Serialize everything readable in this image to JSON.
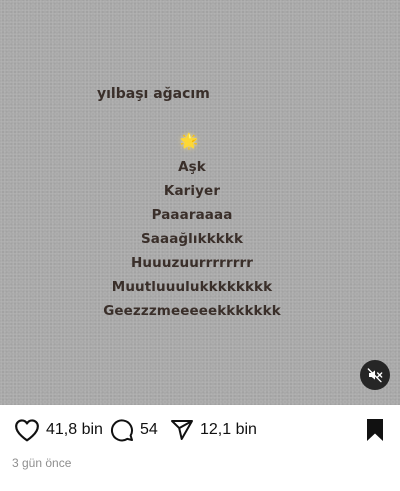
{
  "post": {
    "title": "yılbaşı ağacım",
    "star_glyph": "🌟",
    "tree_lines": [
      "Aşk",
      "Kariyer",
      "Paaaraaaa",
      "Saaağlıkkkkk",
      "Huuuzuurrrrrrrr",
      "Muutluuulukkkkkkkk",
      "Geezzzmeeeeekkkkkkk"
    ]
  },
  "media_controls": {
    "mute_icon": "volume-muted-icon"
  },
  "actions": {
    "like_count": "41,8 bin",
    "comment_count": "54",
    "share_count": "12,1 bin",
    "icons": {
      "like": "heart-icon",
      "comment": "comment-bubble-icon",
      "share": "paper-plane-icon",
      "save": "bookmark-icon"
    }
  },
  "timestamp": "3 gün önce",
  "colors": {
    "background_gray": "#a9a9a9",
    "text_brown": "#3a2f2a",
    "star_yellow": "#f5c62a",
    "mute_button": "#262626",
    "timestamp_gray": "#8e8e8e"
  }
}
